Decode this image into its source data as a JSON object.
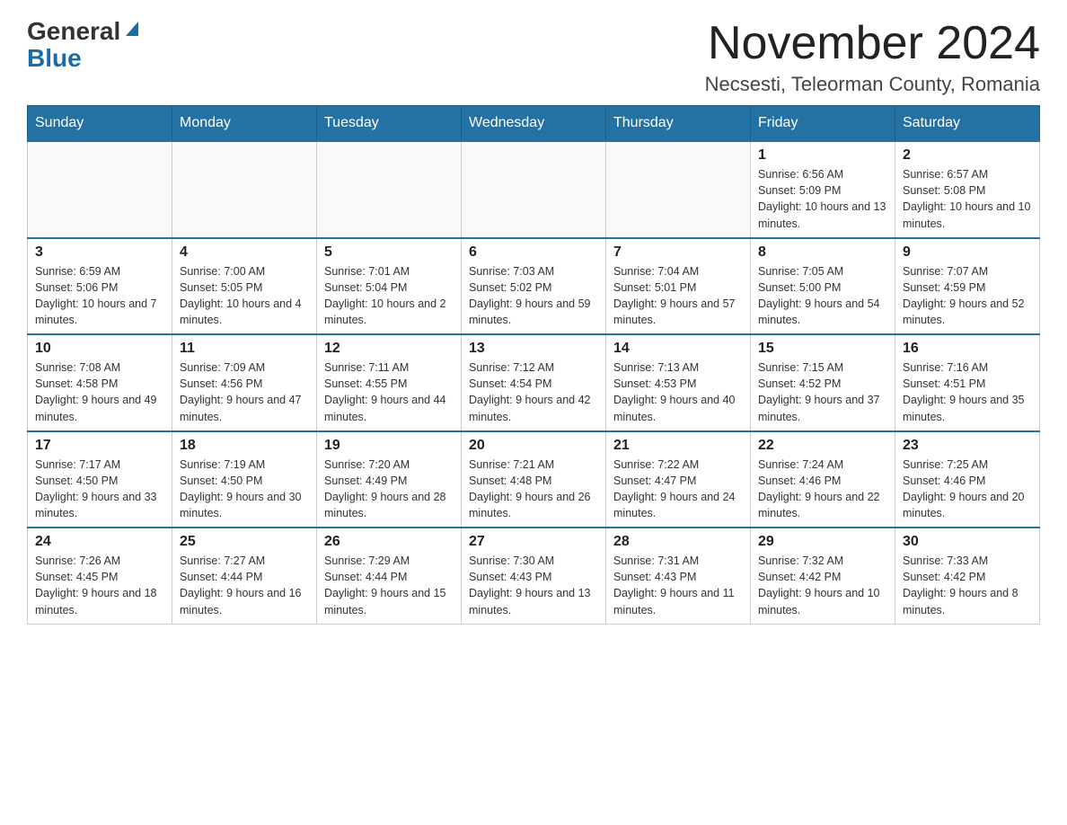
{
  "header": {
    "logo_general": "General",
    "logo_blue": "Blue",
    "month_title": "November 2024",
    "location": "Necsesti, Teleorman County, Romania"
  },
  "weekdays": [
    "Sunday",
    "Monday",
    "Tuesday",
    "Wednesday",
    "Thursday",
    "Friday",
    "Saturday"
  ],
  "weeks": [
    [
      {
        "day": "",
        "info": ""
      },
      {
        "day": "",
        "info": ""
      },
      {
        "day": "",
        "info": ""
      },
      {
        "day": "",
        "info": ""
      },
      {
        "day": "",
        "info": ""
      },
      {
        "day": "1",
        "info": "Sunrise: 6:56 AM\nSunset: 5:09 PM\nDaylight: 10 hours and 13 minutes."
      },
      {
        "day": "2",
        "info": "Sunrise: 6:57 AM\nSunset: 5:08 PM\nDaylight: 10 hours and 10 minutes."
      }
    ],
    [
      {
        "day": "3",
        "info": "Sunrise: 6:59 AM\nSunset: 5:06 PM\nDaylight: 10 hours and 7 minutes."
      },
      {
        "day": "4",
        "info": "Sunrise: 7:00 AM\nSunset: 5:05 PM\nDaylight: 10 hours and 4 minutes."
      },
      {
        "day": "5",
        "info": "Sunrise: 7:01 AM\nSunset: 5:04 PM\nDaylight: 10 hours and 2 minutes."
      },
      {
        "day": "6",
        "info": "Sunrise: 7:03 AM\nSunset: 5:02 PM\nDaylight: 9 hours and 59 minutes."
      },
      {
        "day": "7",
        "info": "Sunrise: 7:04 AM\nSunset: 5:01 PM\nDaylight: 9 hours and 57 minutes."
      },
      {
        "day": "8",
        "info": "Sunrise: 7:05 AM\nSunset: 5:00 PM\nDaylight: 9 hours and 54 minutes."
      },
      {
        "day": "9",
        "info": "Sunrise: 7:07 AM\nSunset: 4:59 PM\nDaylight: 9 hours and 52 minutes."
      }
    ],
    [
      {
        "day": "10",
        "info": "Sunrise: 7:08 AM\nSunset: 4:58 PM\nDaylight: 9 hours and 49 minutes."
      },
      {
        "day": "11",
        "info": "Sunrise: 7:09 AM\nSunset: 4:56 PM\nDaylight: 9 hours and 47 minutes."
      },
      {
        "day": "12",
        "info": "Sunrise: 7:11 AM\nSunset: 4:55 PM\nDaylight: 9 hours and 44 minutes."
      },
      {
        "day": "13",
        "info": "Sunrise: 7:12 AM\nSunset: 4:54 PM\nDaylight: 9 hours and 42 minutes."
      },
      {
        "day": "14",
        "info": "Sunrise: 7:13 AM\nSunset: 4:53 PM\nDaylight: 9 hours and 40 minutes."
      },
      {
        "day": "15",
        "info": "Sunrise: 7:15 AM\nSunset: 4:52 PM\nDaylight: 9 hours and 37 minutes."
      },
      {
        "day": "16",
        "info": "Sunrise: 7:16 AM\nSunset: 4:51 PM\nDaylight: 9 hours and 35 minutes."
      }
    ],
    [
      {
        "day": "17",
        "info": "Sunrise: 7:17 AM\nSunset: 4:50 PM\nDaylight: 9 hours and 33 minutes."
      },
      {
        "day": "18",
        "info": "Sunrise: 7:19 AM\nSunset: 4:50 PM\nDaylight: 9 hours and 30 minutes."
      },
      {
        "day": "19",
        "info": "Sunrise: 7:20 AM\nSunset: 4:49 PM\nDaylight: 9 hours and 28 minutes."
      },
      {
        "day": "20",
        "info": "Sunrise: 7:21 AM\nSunset: 4:48 PM\nDaylight: 9 hours and 26 minutes."
      },
      {
        "day": "21",
        "info": "Sunrise: 7:22 AM\nSunset: 4:47 PM\nDaylight: 9 hours and 24 minutes."
      },
      {
        "day": "22",
        "info": "Sunrise: 7:24 AM\nSunset: 4:46 PM\nDaylight: 9 hours and 22 minutes."
      },
      {
        "day": "23",
        "info": "Sunrise: 7:25 AM\nSunset: 4:46 PM\nDaylight: 9 hours and 20 minutes."
      }
    ],
    [
      {
        "day": "24",
        "info": "Sunrise: 7:26 AM\nSunset: 4:45 PM\nDaylight: 9 hours and 18 minutes."
      },
      {
        "day": "25",
        "info": "Sunrise: 7:27 AM\nSunset: 4:44 PM\nDaylight: 9 hours and 16 minutes."
      },
      {
        "day": "26",
        "info": "Sunrise: 7:29 AM\nSunset: 4:44 PM\nDaylight: 9 hours and 15 minutes."
      },
      {
        "day": "27",
        "info": "Sunrise: 7:30 AM\nSunset: 4:43 PM\nDaylight: 9 hours and 13 minutes."
      },
      {
        "day": "28",
        "info": "Sunrise: 7:31 AM\nSunset: 4:43 PM\nDaylight: 9 hours and 11 minutes."
      },
      {
        "day": "29",
        "info": "Sunrise: 7:32 AM\nSunset: 4:42 PM\nDaylight: 9 hours and 10 minutes."
      },
      {
        "day": "30",
        "info": "Sunrise: 7:33 AM\nSunset: 4:42 PM\nDaylight: 9 hours and 8 minutes."
      }
    ]
  ]
}
